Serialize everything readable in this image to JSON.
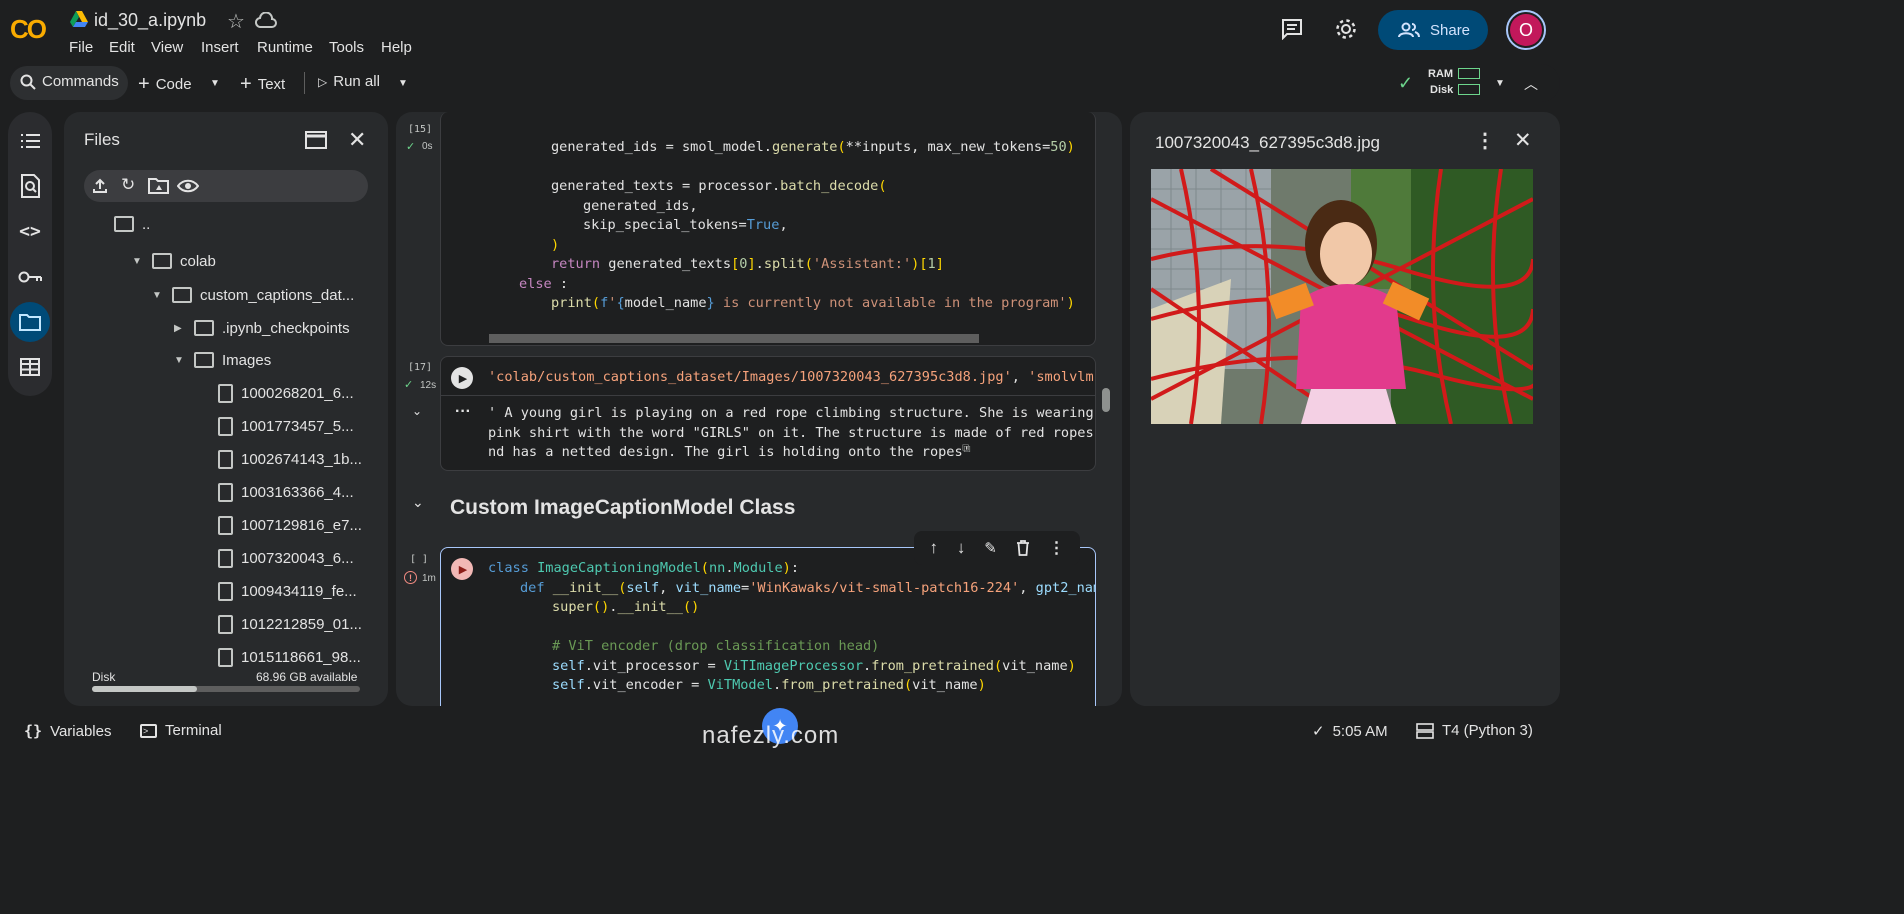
{
  "app": {
    "logo": "CO",
    "title": "id_30_a.ipynb"
  },
  "menu": [
    "File",
    "Edit",
    "View",
    "Insert",
    "Runtime",
    "Tools",
    "Help"
  ],
  "header": {
    "share_label": "Share",
    "avatar_initial": "O"
  },
  "toolbar": {
    "commands": "Commands",
    "code": "Code",
    "text": "Text",
    "run_all": "Run all",
    "ram": "RAM",
    "disk": "Disk"
  },
  "files": {
    "title": "Files",
    "tree": [
      {
        "label": "..",
        "type": "folder"
      },
      {
        "label": "colab",
        "type": "folder"
      },
      {
        "label": "custom_captions_dat...",
        "type": "folder"
      },
      {
        "label": ".ipynb_checkpoints",
        "type": "folder"
      },
      {
        "label": "Images",
        "type": "folder"
      },
      {
        "label": "1000268201_6...",
        "type": "file"
      },
      {
        "label": "1001773457_5...",
        "type": "file"
      },
      {
        "label": "1002674143_1b...",
        "type": "file"
      },
      {
        "label": "1003163366_4...",
        "type": "file"
      },
      {
        "label": "1007129816_e7...",
        "type": "file"
      },
      {
        "label": "1007320043_6...",
        "type": "file"
      },
      {
        "label": "1009434119_fe...",
        "type": "file"
      },
      {
        "label": "1012212859_01...",
        "type": "file"
      },
      {
        "label": "1015118661_98..."
      }
    ],
    "disk_label": "Disk",
    "disk_available": "68.96 GB available",
    "disk_used_fraction": 0.39
  },
  "cells": {
    "c15": {
      "count": "[15]",
      "time": "0s"
    },
    "c17": {
      "count": "[17]",
      "time": "12s",
      "output": "' A young girl is playing on a red rope climbing structure. She is wearing a\npink shirt with the word \"GIRLS\" on it. The structure is made of red ropes a\nnd has a netted design. The girl is holding onto the ropes'"
    },
    "section_title": "Custom ImageCaptionModel Class",
    "c_new": {
      "count": "[ ]",
      "time": "1m"
    }
  },
  "viewer": {
    "filename": "1007320043_627395c3d8.jpg"
  },
  "statusbar": {
    "variables": "Variables",
    "terminal": "Terminal",
    "time": "5:05 AM",
    "runtime": "T4 (Python 3)"
  },
  "watermark": {
    "text": "nafezly.com"
  }
}
